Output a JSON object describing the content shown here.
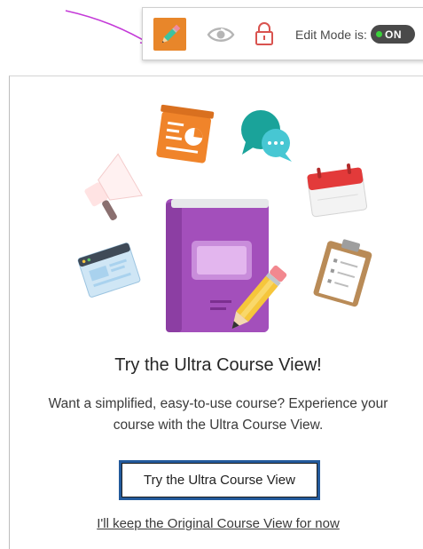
{
  "toolbar": {
    "edit_mode_label": "Edit Mode is:",
    "edit_mode_state": "ON",
    "icons": [
      "pencil-icon",
      "eye-icon",
      "lock-icon"
    ],
    "accent_color": "#e8862a",
    "toggle_dot_color": "#3bd13b"
  },
  "promo": {
    "headline": "Try the Ultra Course View!",
    "description": "Want a simplified, easy-to-use course? Experience your course with the Ultra Course View.",
    "primary_button": "Try the Ultra Course View",
    "secondary_link": "I'll keep the Original Course View for now",
    "illustration_icons": [
      "presentation-icon",
      "chat-bubbles-icon",
      "megaphone-icon",
      "calendar-icon",
      "browser-window-icon",
      "clipboard-icon",
      "book-icon",
      "pencil-icon"
    ]
  }
}
